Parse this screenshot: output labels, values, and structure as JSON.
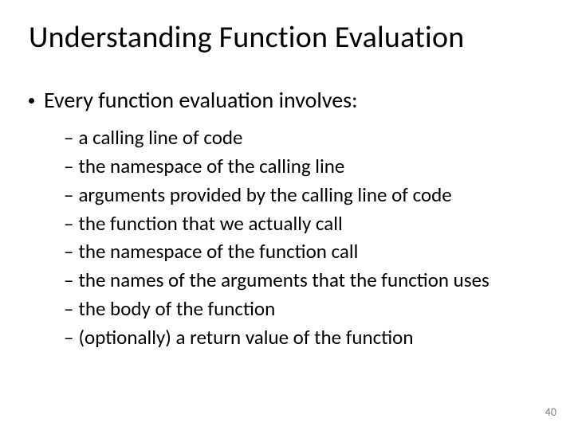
{
  "title": "Understanding Function Evaluation",
  "main": {
    "items": [
      {
        "text": "Every function evaluation involves:"
      }
    ]
  },
  "sub": {
    "items": [
      {
        "text": "a calling line of code"
      },
      {
        "text": "the namespace of the calling line"
      },
      {
        "text": "arguments provided by the calling line of code"
      },
      {
        "text": "the function that we actually call"
      },
      {
        "text": "the namespace of the function call"
      },
      {
        "text": "the names of the arguments that the function uses"
      },
      {
        "text": "the body of the function"
      },
      {
        "text": "(optionally) a return value of the function"
      }
    ]
  },
  "page_number": "40"
}
